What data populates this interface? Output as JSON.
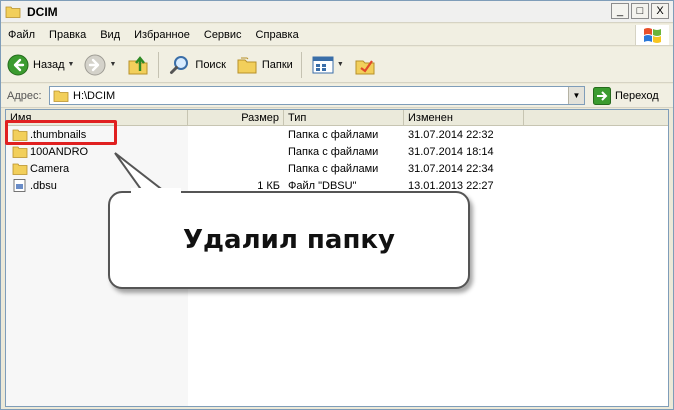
{
  "window": {
    "title": "DCIM"
  },
  "controls": {
    "minimize": "_",
    "maximize": "□",
    "close": "X"
  },
  "menu": [
    "Файл",
    "Правка",
    "Вид",
    "Избранное",
    "Сервис",
    "Справка"
  ],
  "toolbar": {
    "back_label": "Назад",
    "search_label": "Поиск",
    "folders_label": "Папки"
  },
  "address": {
    "label": "Адрес:",
    "value": "H:\\DCIM",
    "go_label": "Переход"
  },
  "columns": {
    "name": "Имя",
    "size": "Размер",
    "type": "Тип",
    "modified": "Изменен"
  },
  "files": [
    {
      "name": ".thumbnails",
      "size": "",
      "type": "Папка с файлами",
      "modified": "31.07.2014 22:32",
      "icon": "folder-icon"
    },
    {
      "name": "100ANDRO",
      "size": "",
      "type": "Папка с файлами",
      "modified": "31.07.2014 18:14",
      "icon": "folder-icon"
    },
    {
      "name": "Camera",
      "size": "",
      "type": "Папка с файлами",
      "modified": "31.07.2014 22:34",
      "icon": "folder-icon"
    },
    {
      "name": ".dbsu",
      "size": "1 КБ",
      "type": "Файл \"DBSU\"",
      "modified": "13.01.2013 22:27",
      "icon": "file-icon"
    }
  ],
  "callout": {
    "text": "Удалил папку"
  },
  "colors": {
    "highlight": "#e02020",
    "folder": "#f2cf5b"
  }
}
